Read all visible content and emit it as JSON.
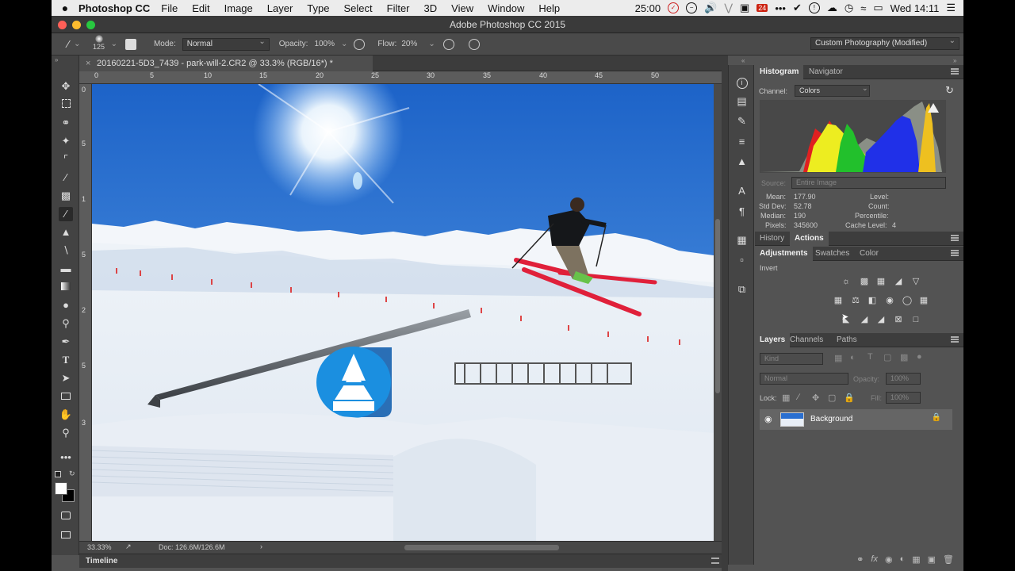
{
  "menubar": {
    "apple": "",
    "app_name": "Photoshop CC",
    "items": [
      "File",
      "Edit",
      "Image",
      "Layer",
      "Type",
      "Select",
      "Filter",
      "3D",
      "View",
      "Window",
      "Help"
    ],
    "timer": "25:00",
    "calendar_day": "24",
    "clock": "Wed 14:11"
  },
  "window": {
    "title": "Adobe Photoshop CC 2015"
  },
  "options": {
    "brush_size": "125",
    "mode_label": "Mode:",
    "mode_value": "Normal",
    "opacity_label": "Opacity:",
    "opacity_value": "100%",
    "flow_label": "Flow:",
    "flow_value": "20%",
    "workspace": "Custom Photography (Modified)"
  },
  "document": {
    "tab_title": "20160221-5D3_7439 - park-will-2.CR2 @ 33.3% (RGB/16*) *",
    "ruler_h": [
      "0",
      "5",
      "10",
      "15",
      "20",
      "25",
      "30",
      "35",
      "40",
      "45",
      "50"
    ],
    "ruler_v": [
      "0",
      "5",
      "1",
      "5",
      "2",
      "5",
      "3"
    ],
    "zoom": "33.33%",
    "doc_size": "Doc: 126.6M/126.6M",
    "timeline_label": "Timeline"
  },
  "histogram": {
    "tabs": [
      "Histogram",
      "Navigator"
    ],
    "channel_label": "Channel:",
    "channel_value": "Colors",
    "source_label": "Source:",
    "source_value": "Entire Image",
    "stats": {
      "mean_label": "Mean:",
      "mean": "177.90",
      "stddev_label": "Std Dev:",
      "stddev": "52.78",
      "median_label": "Median:",
      "median": "190",
      "pixels_label": "Pixels:",
      "pixels": "345600",
      "level_label": "Level:",
      "count_label": "Count:",
      "percentile_label": "Percentile:",
      "cache_label": "Cache Level:",
      "cache": "4"
    }
  },
  "history_tabs": [
    "History",
    "Actions"
  ],
  "adjustments": {
    "tabs": [
      "Adjustments",
      "Swatches",
      "Color"
    ],
    "hover_label": "Invert"
  },
  "layers": {
    "tabs": [
      "Layers",
      "Channels",
      "Paths"
    ],
    "kind_placeholder": "Kind",
    "blend_mode": "Normal",
    "opacity_label": "Opacity:",
    "opacity_value": "100%",
    "lock_label": "Lock:",
    "fill_label": "Fill:",
    "fill_value": "100%",
    "items": [
      {
        "name": "Background"
      }
    ]
  },
  "colors": {
    "ui_bg": "#535353",
    "panel_dark": "#3d3d3d",
    "sky": "#1f6fd0",
    "rail_badge": "#1b8fe0",
    "ski_red": "#e0203a"
  }
}
